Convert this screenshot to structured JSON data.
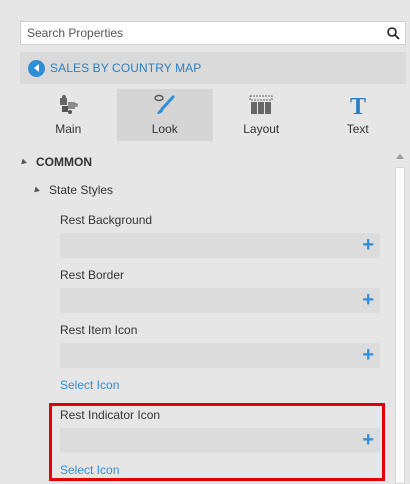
{
  "search": {
    "placeholder": "Search Properties"
  },
  "breadcrumb": {
    "label": "SALES BY COUNTRY MAP"
  },
  "tabs": [
    {
      "label": "Main",
      "icon": "puzzle-icon"
    },
    {
      "label": "Look",
      "icon": "paintbrush-icon",
      "active": true
    },
    {
      "label": "Layout",
      "icon": "layout-icon"
    },
    {
      "label": "Text",
      "icon": "text-icon"
    }
  ],
  "section": {
    "label": "COMMON"
  },
  "subsection": {
    "label": "State Styles"
  },
  "properties": {
    "rest_background": {
      "label": "Rest Background"
    },
    "rest_border": {
      "label": "Rest Border"
    },
    "rest_item_icon": {
      "label": "Rest Item Icon",
      "link": "Select Icon"
    },
    "rest_indicator_icon": {
      "label": "Rest Indicator Icon",
      "link": "Select Icon"
    }
  },
  "colors": {
    "accent": "#2e8fd6",
    "highlight": "#e30000"
  }
}
